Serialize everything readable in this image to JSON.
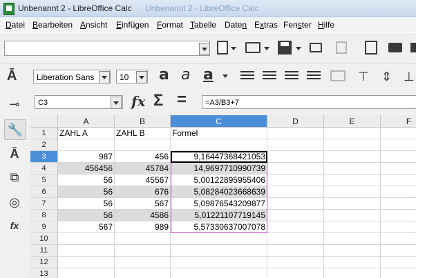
{
  "window": {
    "title": "Unbenannt 2 - LibreOffice Calc",
    "ghost_title": "Unbenannt 2 - LibreOffice Calc"
  },
  "menu": [
    {
      "label": "Datei",
      "ul": "D"
    },
    {
      "label": "Bearbeiten",
      "ul": "B"
    },
    {
      "label": "Ansicht",
      "ul": "A"
    },
    {
      "label": "Einfügen",
      "ul": "E"
    },
    {
      "label": "Format",
      "ul": "F"
    },
    {
      "label": "Tabelle",
      "ul": "T"
    },
    {
      "label": "Daten",
      "ul": "n"
    },
    {
      "label": "Extras",
      "ul": "x"
    },
    {
      "label": "Fenster",
      "ul": "s"
    },
    {
      "label": "Hilfe",
      "ul": "H"
    }
  ],
  "format_toolbar": {
    "font_name": "Liberation Sans",
    "font_size": "10"
  },
  "formula_bar": {
    "cell_reference": "C3",
    "formula": "=A3/B3+7",
    "function_wizard_icon": "fx",
    "sum_icon": "Σ",
    "equals_icon": "="
  },
  "sheet": {
    "columns": [
      "A",
      "B",
      "C",
      "D",
      "E",
      "F"
    ],
    "active_column": "C",
    "active_row": "3",
    "rows": [
      {
        "n": "1",
        "a": "ZAHL A",
        "b": "ZAHL B",
        "c": "Formel",
        "shade": false
      },
      {
        "n": "2",
        "a": "",
        "b": "",
        "c": "",
        "shade": false
      },
      {
        "n": "3",
        "a": "987",
        "b": "456",
        "c": "9,16447368421053",
        "shade": false
      },
      {
        "n": "4",
        "a": "456456",
        "b": "45784",
        "c": "14,9697710990739",
        "shade": true
      },
      {
        "n": "5",
        "a": "56",
        "b": "45567",
        "c": "5,00122895955406",
        "shade": false
      },
      {
        "n": "6",
        "a": "56",
        "b": "676",
        "c": "5,08284023668639",
        "shade": true
      },
      {
        "n": "7",
        "a": "56",
        "b": "567",
        "c": "5,09876543209877",
        "shade": false
      },
      {
        "n": "8",
        "a": "56",
        "b": "4586",
        "c": "5,01221107719145",
        "shade": true
      },
      {
        "n": "9",
        "a": "567",
        "b": "989",
        "c": "5,57330637007078",
        "shade": false
      },
      {
        "n": "10",
        "a": "",
        "b": "",
        "c": "",
        "shade": false
      },
      {
        "n": "11",
        "a": "",
        "b": "",
        "c": "",
        "shade": false
      },
      {
        "n": "12",
        "a": "",
        "b": "",
        "c": "",
        "shade": false
      },
      {
        "n": "13",
        "a": "",
        "b": "",
        "c": "",
        "shade": false
      }
    ]
  },
  "colors": {
    "accent": "#4a8fd8",
    "selection_border": "#c13fbf"
  }
}
